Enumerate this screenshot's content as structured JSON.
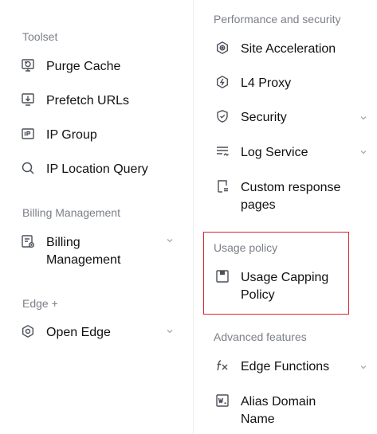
{
  "left": {
    "toolset_title": "Toolset",
    "toolset_items": [
      {
        "label": "Purge Cache",
        "icon": "purge-cache-icon"
      },
      {
        "label": "Prefetch URLs",
        "icon": "prefetch-icon"
      },
      {
        "label": "IP Group",
        "icon": "ip-group-icon"
      },
      {
        "label": "IP Location Query",
        "icon": "search-icon"
      }
    ],
    "billing_title": "Billing Management",
    "billing_item": {
      "label_line1": "Billing",
      "label_line2": "Management",
      "icon": "billing-icon"
    },
    "edge_title": "Edge +",
    "edge_item": {
      "label": "Open Edge",
      "icon": "open-edge-icon"
    }
  },
  "right": {
    "perf_title": "Performance and security",
    "perf_items": [
      {
        "label": "Site Acceleration",
        "icon": "site-acceleration-icon"
      },
      {
        "label": "L4 Proxy",
        "icon": "l4-proxy-icon"
      },
      {
        "label": "Security",
        "icon": "shield-icon"
      },
      {
        "label": "Log Service",
        "icon": "log-service-icon"
      }
    ],
    "custom_pages": {
      "label_line1": "Custom response",
      "label_line2": "pages",
      "icon": "custom-pages-icon"
    },
    "usage_title": "Usage policy",
    "usage_item": {
      "label_line1": "Usage Capping",
      "label_line2": "Policy",
      "icon": "usage-capping-icon"
    },
    "advanced_title": "Advanced features",
    "edge_functions": {
      "label": "Edge Functions",
      "icon": "fx-icon"
    },
    "alias_domain": {
      "label_line1": "Alias Domain",
      "label_line2": "Name",
      "icon": "alias-domain-icon"
    }
  },
  "colors": {
    "highlight": "#d9232e",
    "muted": "#7b7f87",
    "text": "#0f1114"
  }
}
